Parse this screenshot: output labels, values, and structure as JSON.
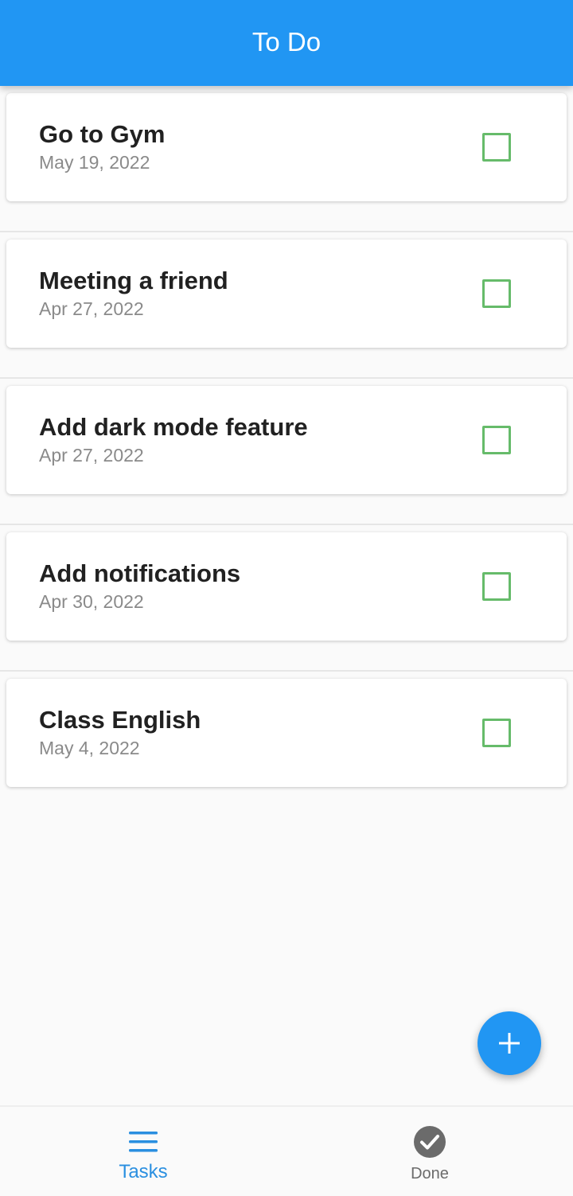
{
  "app_bar": {
    "title": "To Do"
  },
  "tasks": [
    {
      "title": "Go to Gym",
      "date": "May 19, 2022",
      "done": false
    },
    {
      "title": "Meeting a friend",
      "date": "Apr 27, 2022",
      "done": false
    },
    {
      "title": "Add dark mode feature",
      "date": "Apr 27, 2022",
      "done": false
    },
    {
      "title": "Add notifications",
      "date": "Apr 30, 2022",
      "done": false
    },
    {
      "title": "Class English",
      "date": "May 4, 2022",
      "done": false
    }
  ],
  "fab": {
    "icon": "plus-icon"
  },
  "bottom_nav": {
    "items": [
      {
        "label": "Tasks",
        "icon": "menu-icon",
        "active": true
      },
      {
        "label": "Done",
        "icon": "check-circle-icon",
        "active": false
      }
    ]
  },
  "colors": {
    "primary": "#2196f3",
    "checkbox": "#66bb6a",
    "inactive_nav": "#6b6b6b"
  }
}
